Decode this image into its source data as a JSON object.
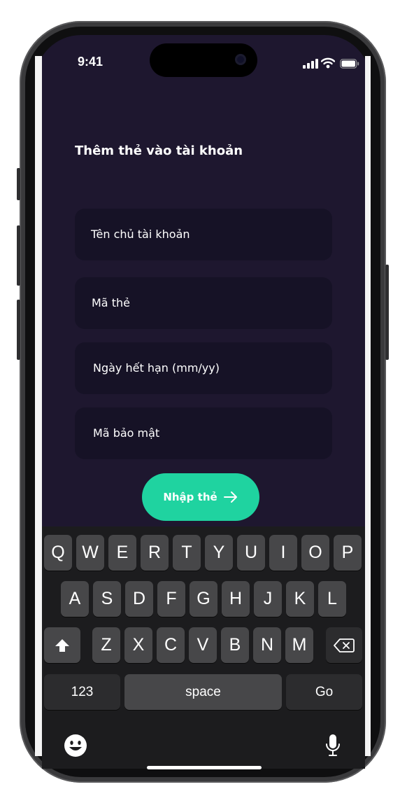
{
  "status_bar": {
    "time": "9:41"
  },
  "form": {
    "title": "Thêm thẻ vào tài khoản",
    "fields": [
      {
        "placeholder": "Tên chủ tài khoản"
      },
      {
        "placeholder": "Mã thẻ"
      },
      {
        "placeholder": "Ngày hết hạn (mm/yy)"
      },
      {
        "placeholder": "Mã bảo mật"
      }
    ],
    "submit_label": "Nhập thẻ"
  },
  "keyboard": {
    "row1": [
      "Q",
      "W",
      "E",
      "R",
      "T",
      "Y",
      "U",
      "I",
      "O",
      "P"
    ],
    "row2": [
      "A",
      "S",
      "D",
      "F",
      "G",
      "H",
      "J",
      "K",
      "L"
    ],
    "row3": [
      "Z",
      "X",
      "C",
      "V",
      "B",
      "N",
      "M"
    ],
    "numbers_label": "123",
    "space_label": "space",
    "go_label": "Go"
  },
  "colors": {
    "screen_background": "#1e172f",
    "field_background": "#161226",
    "accent": "#1fd3a0",
    "keyboard_background": "#1c1c1e",
    "key_background": "#474749"
  },
  "icons": [
    "signal-icon",
    "wifi-icon",
    "battery-icon",
    "arrow-right-icon",
    "shift-icon",
    "backspace-icon",
    "emoji-icon",
    "microphone-icon"
  ]
}
